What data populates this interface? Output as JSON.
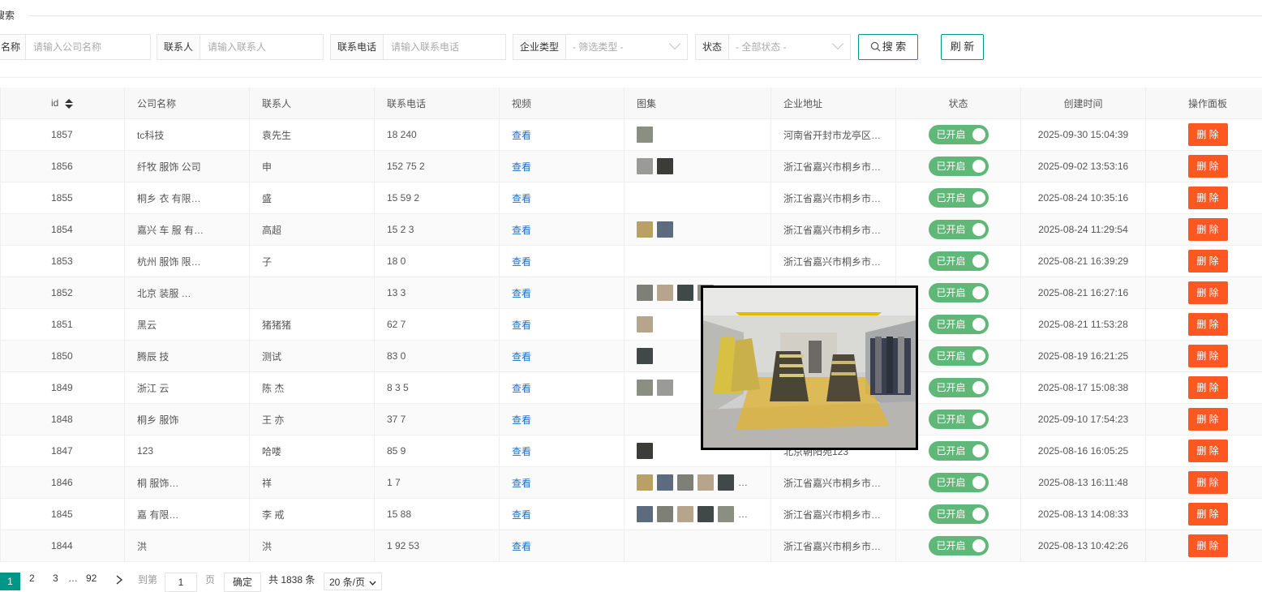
{
  "search": {
    "legend": "搜索",
    "company": {
      "label": "名称",
      "placeholder": "请输入公司名称"
    },
    "contact": {
      "label": "联系人",
      "placeholder": "请输入联系人"
    },
    "phone": {
      "label": "联系电话",
      "placeholder": "请输入联系电话"
    },
    "type": {
      "label": "企业类型",
      "value": "- 筛选类型 -"
    },
    "status": {
      "label": "状态",
      "value": "- 全部状态 -"
    },
    "search_button": "搜 索",
    "refresh_button": "刷 新"
  },
  "table": {
    "headers": [
      "id",
      "公司名称",
      "联系人",
      "联系电话",
      "视频",
      "图集",
      "企业地址",
      "状态",
      "创建时间",
      "操作面板"
    ],
    "view_label": "查看",
    "status_label": "已开启",
    "delete_label": "删 除",
    "rows": [
      {
        "id": "1857",
        "company": "tc科技",
        "contact": "袁先生",
        "phone": "18       240",
        "address": "河南省开封市龙亭区…",
        "created": "2025-09-30 15:04:39",
        "thumbs": 1
      },
      {
        "id": "1856",
        "company": "纤牧    服饰    公司",
        "contact": "申",
        "phone": "152   75    2",
        "address": "浙江省嘉兴市桐乡市…",
        "created": "2025-09-02 13:53:16",
        "thumbs": 2
      },
      {
        "id": "1855",
        "company": "桐乡    衣       有限…",
        "contact": "盛",
        "phone": "15       59   2",
        "address": "浙江省嘉兴市桐乡市…",
        "created": "2025-08-24 10:35:16",
        "thumbs": 0
      },
      {
        "id": "1854",
        "company": "嘉兴    车    服    有…",
        "contact": "高超",
        "phone": "15          2   3",
        "address": "浙江省嘉兴市桐乡市…",
        "created": "2025-08-24 11:29:54",
        "thumbs": 2
      },
      {
        "id": "1853",
        "company": "杭州       服饰   限…",
        "contact": "   子",
        "phone": "18        0",
        "address": "浙江省嘉兴市桐乡市…",
        "created": "2025-08-21 16:39:29",
        "thumbs": 0
      },
      {
        "id": "1852",
        "company": "北京    装服    …",
        "contact": "",
        "phone": "13          3",
        "address": "",
        "created": "2025-08-21 16:27:16",
        "thumbs": 4
      },
      {
        "id": "1851",
        "company": "黑云",
        "contact": "猪猪猪",
        "phone": "  62      7",
        "address": "",
        "created": "2025-08-21 11:53:28",
        "thumbs": 1
      },
      {
        "id": "1850",
        "company": "腾辰   技",
        "contact": "测试",
        "phone": "  83      0",
        "address": "",
        "created": "2025-08-19 16:21:25",
        "thumbs": 1
      },
      {
        "id": "1849",
        "company": "浙江    云",
        "contact": "陈   杰",
        "phone": "  8     3   5",
        "address": "",
        "created": "2025-08-17 15:08:38",
        "thumbs": 2
      },
      {
        "id": "1848",
        "company": "桐乡       服饰",
        "contact": "王   亦",
        "phone": "   37    7",
        "address": "",
        "created": "2025-09-10 17:54:23",
        "thumbs": 0
      },
      {
        "id": "1847",
        "company": "123",
        "contact": "哈喽",
        "phone": "    85   9",
        "address": "北京朝阳苑123",
        "created": "2025-08-16 16:05:25",
        "thumbs": 1
      },
      {
        "id": "1846",
        "company": "桐        服饰…",
        "contact": "   祥",
        "phone": "       1   7",
        "address": "浙江省嘉兴市桐乡市…",
        "created": "2025-08-13 16:11:48",
        "thumbs": 5
      },
      {
        "id": "1845",
        "company": "嘉        有限…",
        "contact": "李   戒",
        "phone": "15        88",
        "address": "浙江省嘉兴市桐乡市…",
        "created": "2025-08-13 14:08:33",
        "thumbs": 5
      },
      {
        "id": "1844",
        "company": "洪",
        "contact": "   洪",
        "phone": "1   92   53",
        "address": "浙江省嘉兴市桐乡市…",
        "created": "2025-08-13 10:42:26",
        "thumbs": 0
      }
    ]
  },
  "pagination": {
    "current": "1",
    "p2": "2",
    "p3": "3",
    "ellipsis": "…",
    "last": "92",
    "goto_label": "到第",
    "goto_value": "1",
    "page_suffix": "页",
    "confirm": "确定",
    "total": "共 1838 条",
    "page_size": "20 条/页"
  },
  "colors": {
    "accent": "#009688",
    "switch_on": "#5FB878",
    "danger": "#FF5722",
    "link": "#1E6FC3"
  }
}
